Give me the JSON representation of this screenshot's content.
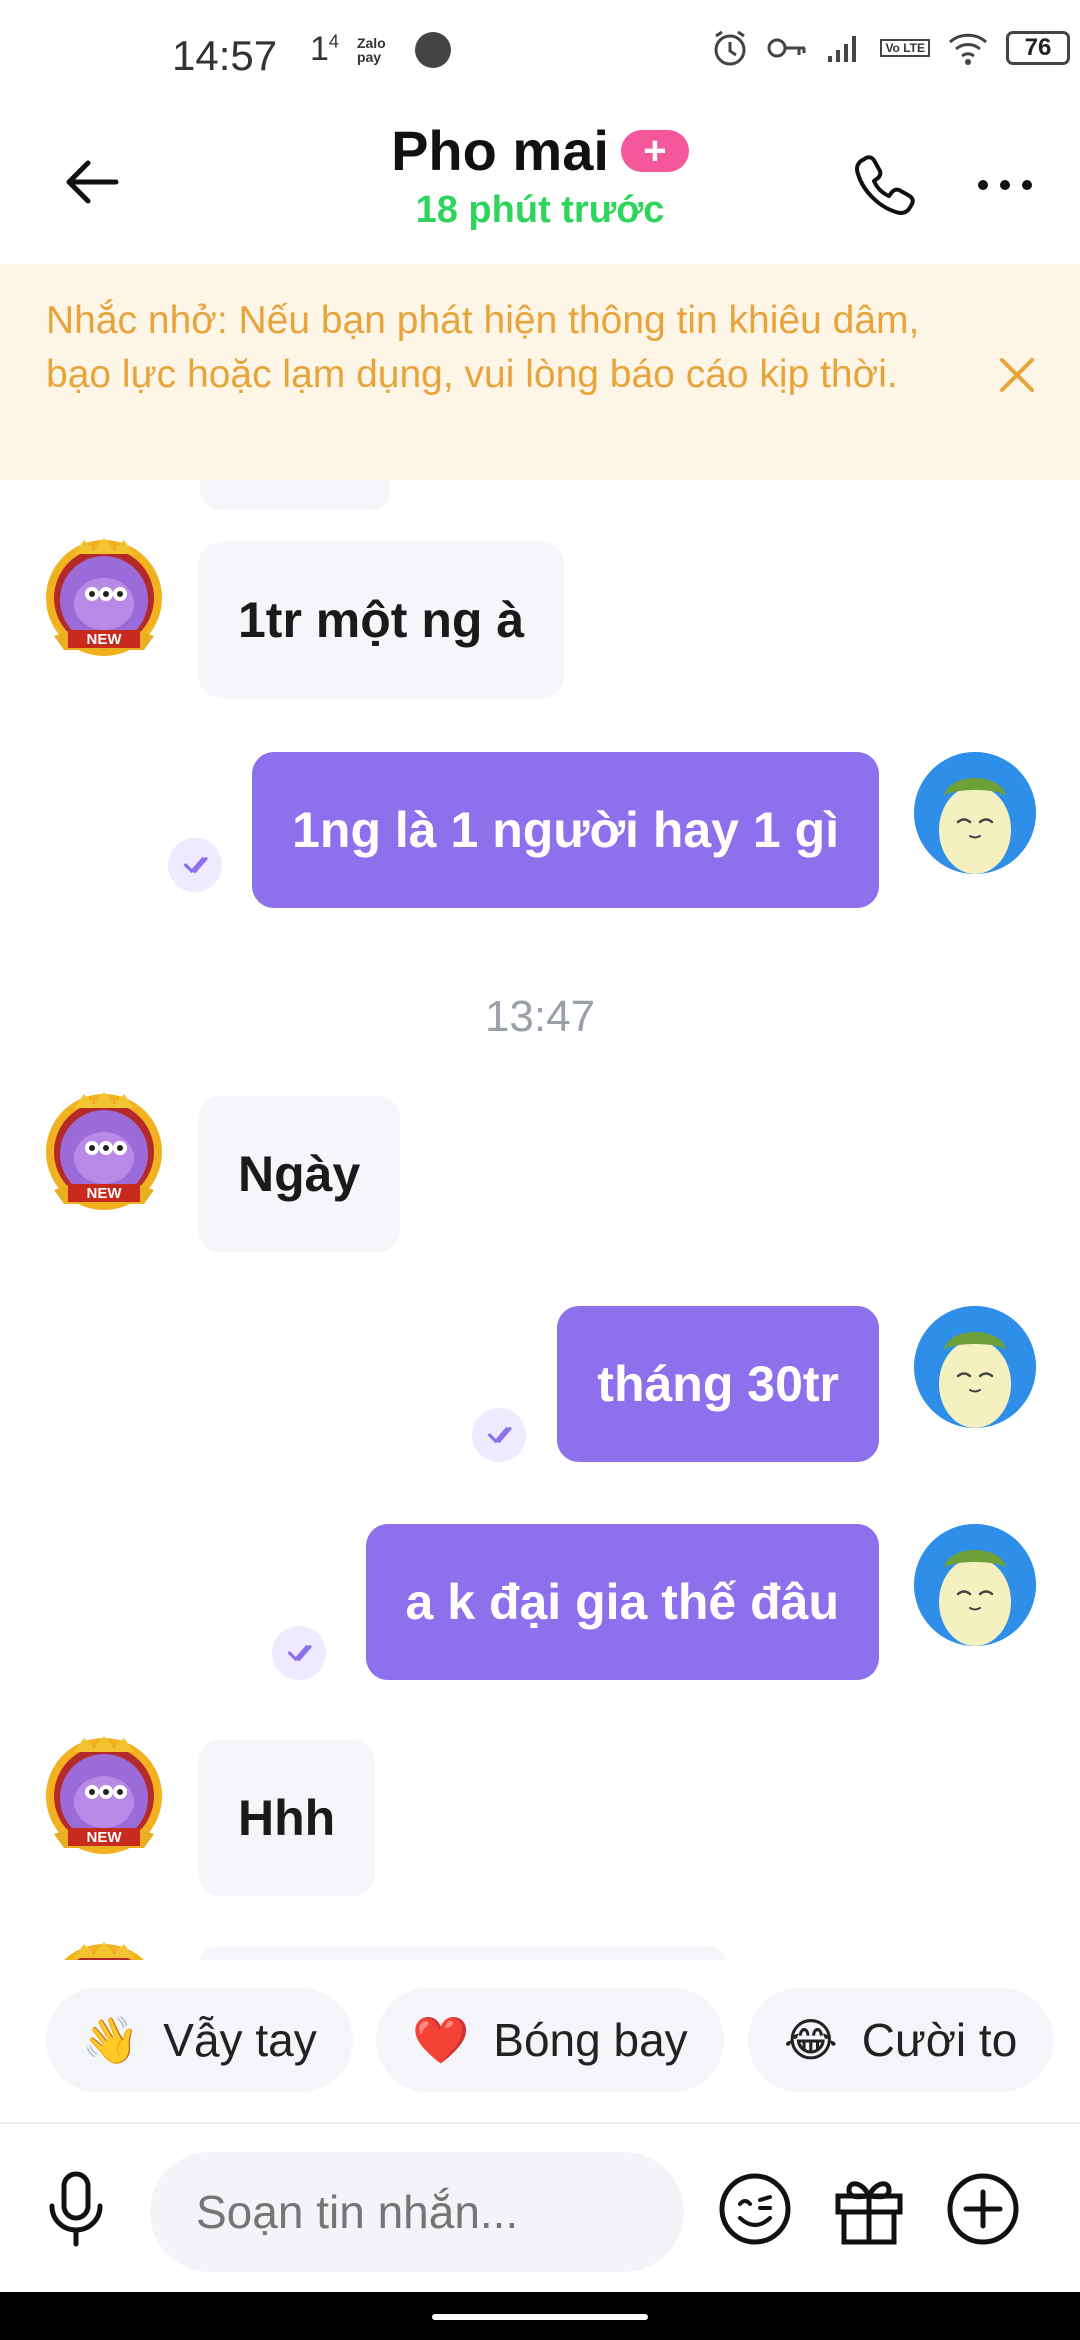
{
  "status_bar": {
    "time": "14:57",
    "notif_1": "1",
    "notif_1_sup": "4",
    "zalopay_line1": "Zalo",
    "zalopay_line2": "pay",
    "lte_label": "Vo LTE",
    "battery": "76"
  },
  "header": {
    "title": "Pho mai",
    "add_label": "+",
    "subtitle": "18 phút trước"
  },
  "banner": {
    "text": "Nhắc nhở: Nếu bạn phát hiện thông tin khiêu dâm, bạo lực hoặc lạm dụng, vui lòng báo cáo kịp thời."
  },
  "badge_text": "NEW",
  "messages": [
    {
      "side": "received",
      "text": "1tr một ng à"
    },
    {
      "side": "sent",
      "text": "1ng là 1 người hay 1 gì"
    },
    {
      "side": "received",
      "text": "Ngày"
    },
    {
      "side": "sent",
      "text": "tháng 30tr"
    },
    {
      "side": "sent",
      "text": "a k đại gia thế đâu"
    },
    {
      "side": "received",
      "text": "Hhh"
    }
  ],
  "timestamp": "13:47",
  "quick_replies": [
    {
      "emoji": "👋",
      "label": "Vẫy tay"
    },
    {
      "emoji": "❤️",
      "label": "Bóng bay"
    },
    {
      "emoji": "😂",
      "label": "Cười to"
    }
  ],
  "input": {
    "placeholder": "Soạn tin nhắn..."
  },
  "colors": {
    "accent_purple": "#8d71ec",
    "online_green": "#2ed45b",
    "banner_text": "#e8a43b",
    "banner_bg": "#fdf6e6",
    "pink_pill": "#f5589a"
  },
  "icons": [
    "back-arrow-icon",
    "phone-icon",
    "more-icon",
    "close-icon",
    "read-check-icon",
    "mic-icon",
    "emoji-icon",
    "gift-icon",
    "plus-icon"
  ]
}
